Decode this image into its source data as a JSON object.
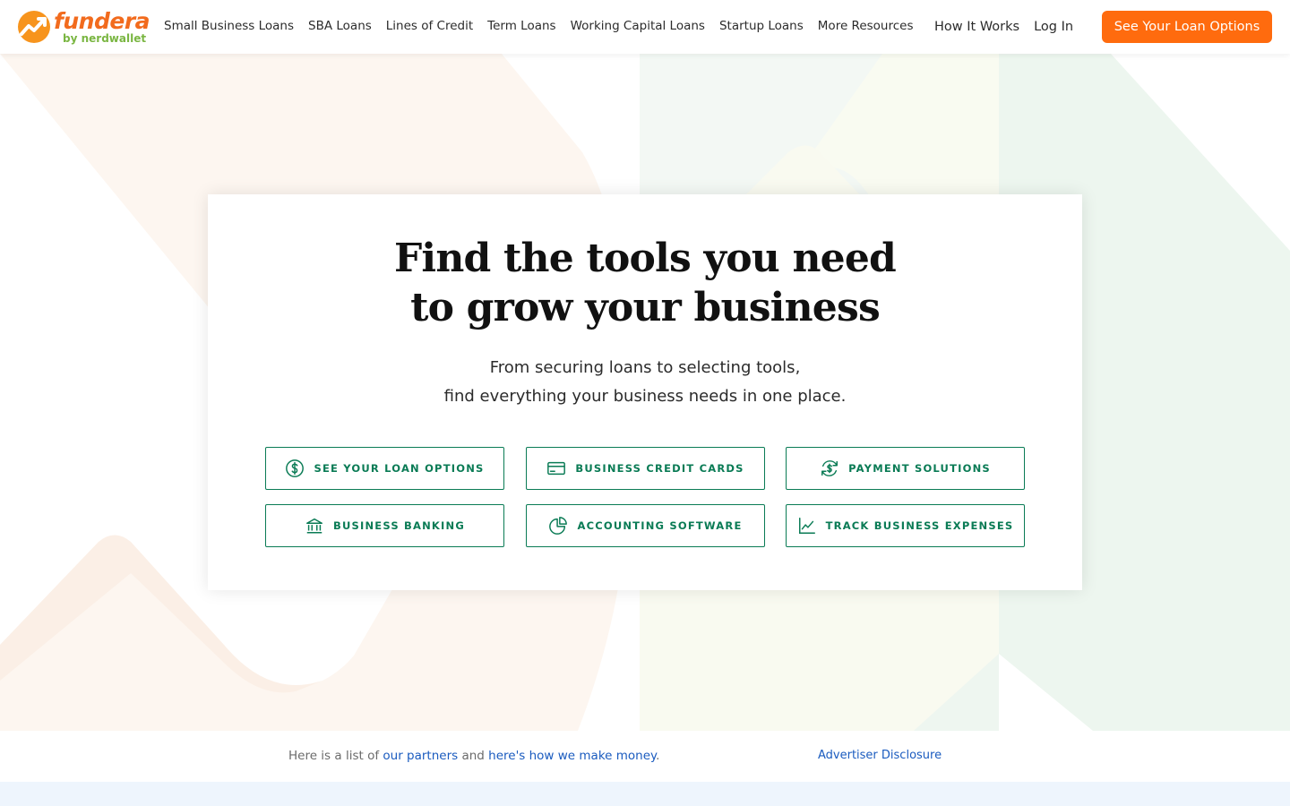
{
  "header": {
    "logo": {
      "brand": "fundera",
      "sub": "by nerdwallet"
    },
    "nav": [
      "Small Business Loans",
      "SBA Loans",
      "Lines of Credit",
      "Term Loans",
      "Working Capital Loans",
      "Startup Loans",
      "More Resources"
    ],
    "how_it_works": "How It Works",
    "log_in": "Log In",
    "cta": "See Your Loan Options"
  },
  "hero": {
    "title_line1": "Find the tools you need",
    "title_line2": "to grow your business",
    "subtitle_line1": "From securing loans to selecting tools,",
    "subtitle_line2": "find everything your business needs in one place.",
    "buttons": [
      {
        "label": "SEE YOUR LOAN OPTIONS",
        "icon": "dollar-circle-icon"
      },
      {
        "label": "BUSINESS CREDIT CARDS",
        "icon": "credit-card-icon"
      },
      {
        "label": "PAYMENT SOLUTIONS",
        "icon": "dollar-cycle-icon"
      },
      {
        "label": "BUSINESS BANKING",
        "icon": "bank-icon"
      },
      {
        "label": "ACCOUNTING SOFTWARE",
        "icon": "pie-chart-icon"
      },
      {
        "label": "TRACK BUSINESS EXPENSES",
        "icon": "line-chart-icon"
      }
    ]
  },
  "disclosure": {
    "prefix": "Here is a list of ",
    "partners_link": "our partners",
    "middle": " and ",
    "money_link": "here's how we make money",
    "suffix": ".",
    "advertiser": "Advertiser Disclosure"
  },
  "colors": {
    "brand_orange": "#ff6b0e",
    "brand_green": "#0a7b55",
    "link_blue": "#1a5bbf"
  }
}
